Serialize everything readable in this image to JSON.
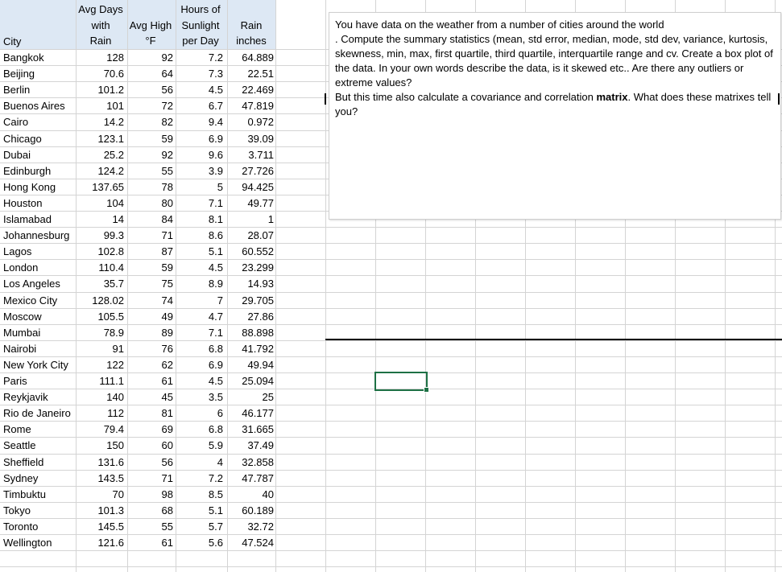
{
  "sheet": {
    "headers": {
      "city": "City",
      "rain_days": [
        "Avg Days",
        "with",
        "Rain"
      ],
      "high": [
        "Avg High",
        "°F"
      ],
      "sun": [
        "Hours of",
        "Sunlight",
        "per Day"
      ],
      "inches": [
        "Rain",
        "inches"
      ]
    },
    "rows": [
      {
        "city": "Bangkok",
        "rain_days": "128",
        "high": "92",
        "sun": "7.2",
        "inches": "64.889"
      },
      {
        "city": "Beijing",
        "rain_days": "70.6",
        "high": "64",
        "sun": "7.3",
        "inches": "22.51"
      },
      {
        "city": "Berlin",
        "rain_days": "101.2",
        "high": "56",
        "sun": "4.5",
        "inches": "22.469"
      },
      {
        "city": "Buenos Aires",
        "rain_days": "101",
        "high": "72",
        "sun": "6.7",
        "inches": "47.819"
      },
      {
        "city": "Cairo",
        "rain_days": "14.2",
        "high": "82",
        "sun": "9.4",
        "inches": "0.972"
      },
      {
        "city": "Chicago",
        "rain_days": "123.1",
        "high": "59",
        "sun": "6.9",
        "inches": "39.09"
      },
      {
        "city": "Dubai",
        "rain_days": "25.2",
        "high": "92",
        "sun": "9.6",
        "inches": "3.711"
      },
      {
        "city": "Edinburgh",
        "rain_days": "124.2",
        "high": "55",
        "sun": "3.9",
        "inches": "27.726"
      },
      {
        "city": "Hong Kong",
        "rain_days": "137.65",
        "high": "78",
        "sun": "5",
        "inches": "94.425"
      },
      {
        "city": "Houston",
        "rain_days": "104",
        "high": "80",
        "sun": "7.1",
        "inches": "49.77"
      },
      {
        "city": "Islamabad",
        "rain_days": "14",
        "high": "84",
        "sun": "8.1",
        "inches": "1"
      },
      {
        "city": "Johannesburg",
        "rain_days": "99.3",
        "high": "71",
        "sun": "8.6",
        "inches": "28.07"
      },
      {
        "city": "Lagos",
        "rain_days": "102.8",
        "high": "87",
        "sun": "5.1",
        "inches": "60.552"
      },
      {
        "city": "London",
        "rain_days": "110.4",
        "high": "59",
        "sun": "4.5",
        "inches": "23.299"
      },
      {
        "city": "Los Angeles",
        "rain_days": "35.7",
        "high": "75",
        "sun": "8.9",
        "inches": "14.93"
      },
      {
        "city": "Mexico City",
        "rain_days": "128.02",
        "high": "74",
        "sun": "7",
        "inches": "29.705"
      },
      {
        "city": "Moscow",
        "rain_days": "105.5",
        "high": "49",
        "sun": "4.7",
        "inches": "27.86"
      },
      {
        "city": "Mumbai",
        "rain_days": "78.9",
        "high": "89",
        "sun": "7.1",
        "inches": "88.898"
      },
      {
        "city": "Nairobi",
        "rain_days": "91",
        "high": "76",
        "sun": "6.8",
        "inches": "41.792"
      },
      {
        "city": "New York City",
        "rain_days": "122",
        "high": "62",
        "sun": "6.9",
        "inches": "49.94"
      },
      {
        "city": "Paris",
        "rain_days": "111.1",
        "high": "61",
        "sun": "4.5",
        "inches": "25.094"
      },
      {
        "city": "Reykjavik",
        "rain_days": "140",
        "high": "45",
        "sun": "3.5",
        "inches": "25"
      },
      {
        "city": "Rio de Janeiro",
        "rain_days": "112",
        "high": "81",
        "sun": "6",
        "inches": "46.177"
      },
      {
        "city": "Rome",
        "rain_days": "79.4",
        "high": "69",
        "sun": "6.8",
        "inches": "31.665"
      },
      {
        "city": "Seattle",
        "rain_days": "150",
        "high": "60",
        "sun": "5.9",
        "inches": "37.49"
      },
      {
        "city": "Sheffield",
        "rain_days": "131.6",
        "high": "56",
        "sun": "4",
        "inches": "32.858"
      },
      {
        "city": "Sydney",
        "rain_days": "143.5",
        "high": "71",
        "sun": "7.2",
        "inches": "47.787"
      },
      {
        "city": "Timbuktu",
        "rain_days": "70",
        "high": "98",
        "sun": "8.5",
        "inches": "40"
      },
      {
        "city": "Tokyo",
        "rain_days": "101.3",
        "high": "68",
        "sun": "5.1",
        "inches": "60.189"
      },
      {
        "city": "Toronto",
        "rain_days": "145.5",
        "high": "55",
        "sun": "5.7",
        "inches": "32.72"
      },
      {
        "city": "Wellington",
        "rain_days": "121.6",
        "high": "61",
        "sun": "5.6",
        "inches": "47.524"
      }
    ]
  },
  "note": {
    "line1": "You have data on the weather from a number of cities around the world",
    "line2": ". Compute the summary statistics (mean, std error, median, mode, std dev, variance, kurtosis, skewness, min, max, first quartile, third quartile, interquartile range and cv. Create a box plot of the data. In your own words describe the data, is it skewed etc.. Are there any outliers or extreme values?",
    "line3_before": "But this time also calculate a covariance and correlation ",
    "line3_bold": "matrix",
    "line3_after": ". What does these matrixes tell you?"
  },
  "colors": {
    "header_bg": "#dde8f4",
    "gridline": "#d4d4d4",
    "selection": "#1e7145"
  }
}
